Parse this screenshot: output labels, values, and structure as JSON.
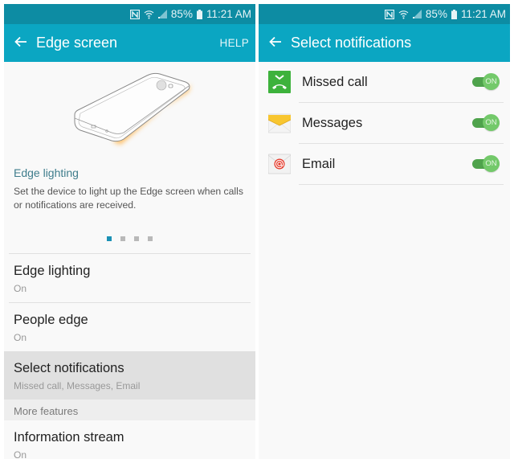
{
  "status_bar": {
    "battery": "85%",
    "time": "11:21 AM",
    "icons": [
      "nfc-icon",
      "wifi-icon",
      "signal-icon",
      "battery-icon"
    ]
  },
  "left_screen": {
    "title": "Edge screen",
    "back_icon": "arrow-left",
    "help_label": "HELP",
    "intro": {
      "title": "Edge lighting",
      "description": "Set the device to light up the Edge screen when calls or notifications are received.",
      "page_count": 4,
      "active_page": 1
    },
    "settings": [
      {
        "name": "Edge lighting",
        "value": "On"
      },
      {
        "name": "People edge",
        "value": "On"
      },
      {
        "name": "Select notifications",
        "value": "Missed call, Messages, Email",
        "selected": true
      }
    ],
    "section_header": "More features",
    "more_settings": [
      {
        "name": "Information stream",
        "value": "On"
      }
    ]
  },
  "right_screen": {
    "title": "Select notifications",
    "back_icon": "arrow-left",
    "items": [
      {
        "label": "Missed call",
        "icon": "missed-call-icon",
        "toggle": "ON"
      },
      {
        "label": "Messages",
        "icon": "messages-icon",
        "toggle": "ON"
      },
      {
        "label": "Email",
        "icon": "email-icon",
        "toggle": "ON"
      }
    ]
  },
  "colors": {
    "status_bar": "#0d8ca3",
    "app_bar": "#0ba6c2",
    "toggle_on": "#73c96a",
    "accent_text": "#3f7d8c"
  }
}
